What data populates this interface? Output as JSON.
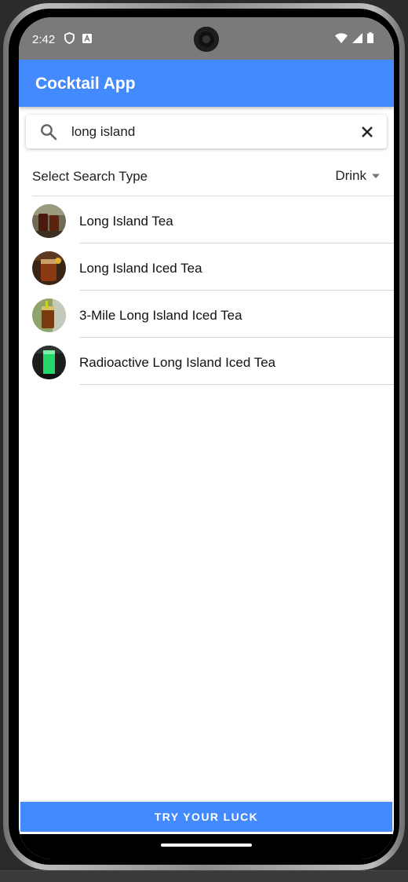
{
  "status_bar": {
    "time": "2:42",
    "left_icons": [
      "shield-icon",
      "a-badge-icon"
    ],
    "right_icons": [
      "wifi-icon",
      "signal-icon",
      "battery-icon"
    ]
  },
  "app_bar": {
    "title": "Cocktail App",
    "color": "#448aff"
  },
  "search": {
    "value": "long island",
    "icon": "search-icon",
    "clear_icon": "close-icon"
  },
  "filter": {
    "label": "Select Search Type",
    "selected": "Drink",
    "icon": "dropdown-arrow-icon"
  },
  "results": [
    {
      "name": "Long Island Tea"
    },
    {
      "name": "Long Island Iced Tea"
    },
    {
      "name": "3-Mile Long Island Iced Tea"
    },
    {
      "name": "Radioactive Long Island Iced Tea"
    }
  ],
  "footer": {
    "button_label": "TRY YOUR LUCK"
  }
}
